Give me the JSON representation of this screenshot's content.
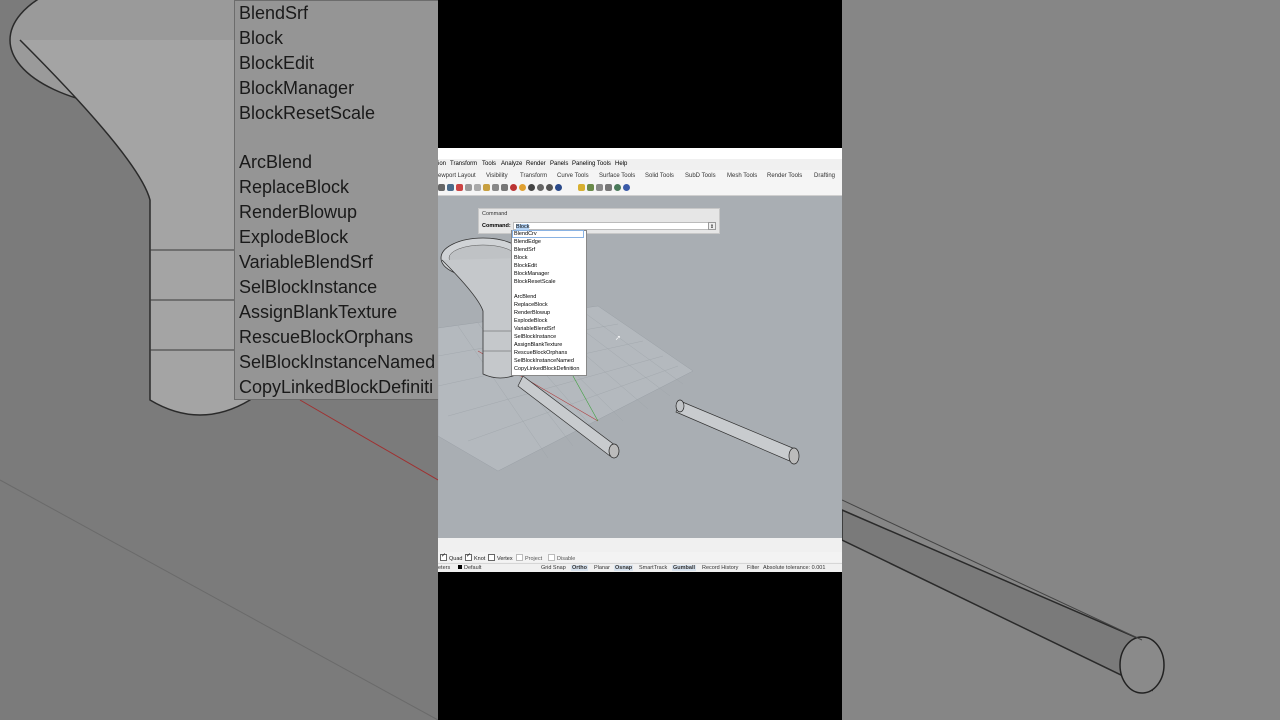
{
  "zoom_list": {
    "items": [
      "BlendSrf",
      "Block",
      "BlockEdit",
      "BlockManager",
      "BlockResetScale",
      "",
      "ArcBlend",
      "ReplaceBlock",
      "RenderBlowup",
      "ExplodeBlock",
      "VariableBlendSrf",
      "SelBlockInstance",
      "AssignBlankTexture",
      "RescueBlockOrphans",
      "SelBlockInstanceNamed",
      "CopyLinkedBlockDefiniti"
    ]
  },
  "menubar": {
    "items": [
      "ion",
      "Transform",
      "Tools",
      "Analyze",
      "Render",
      "Panels",
      "Paneling Tools",
      "Help"
    ]
  },
  "tabs": [
    "ewport Layout",
    "Visibility",
    "Transform",
    "Curve Tools",
    "Surface Tools",
    "Solid Tools",
    "SubD Tools",
    "Mesh Tools",
    "Render Tools",
    "Drafting"
  ],
  "command": {
    "title": "Command",
    "label": "Command:",
    "value": "Block",
    "spin": "⇕"
  },
  "autocomplete": [
    "BlendCrv",
    "BlendEdge",
    "BlendSrf",
    "Block",
    "BlockEdit",
    "BlockManager",
    "BlockResetScale",
    "",
    "ArcBlend",
    "ReplaceBlock",
    "RenderBlowup",
    "ExplodeBlock",
    "VariableBlendSrf",
    "SelBlockInstance",
    "AssignBlankTexture",
    "RescueBlockOrphans",
    "SelBlockInstanceNamed",
    "CopyLinkedBlockDefinition"
  ],
  "filterbar": {
    "quad": "Quad",
    "knot": "Knot",
    "vertex": "Vertex",
    "project": "Project",
    "disable": "Disable"
  },
  "statusbar": {
    "units": "eters",
    "layer": "Default",
    "grid_snap": "Grid Snap",
    "ortho": "Ortho",
    "planar": "Planar",
    "osnap": "Osnap",
    "smarttrack": "SmartTrack",
    "gumball": "Gumball",
    "record_history": "Record History",
    "filter": "Filter",
    "tolerance": "Absolute tolerance: 0.001"
  }
}
